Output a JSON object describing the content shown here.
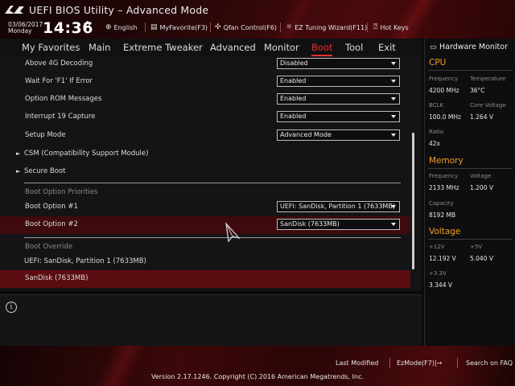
{
  "header": {
    "title": "UEFI BIOS Utility – Advanced Mode",
    "date": "03/06/2017",
    "day": "Monday",
    "time": "14:36",
    "items": [
      {
        "label": "English",
        "icon": "globe-icon"
      },
      {
        "label": "MyFavorite(F3)",
        "icon": "favorite-icon"
      },
      {
        "label": "Qfan Control(F6)",
        "icon": "fan-icon"
      },
      {
        "label": "EZ Tuning Wizard(F11)",
        "icon": "bulb-icon"
      },
      {
        "label": "Hot Keys",
        "icon": "hotkeys-icon"
      }
    ]
  },
  "tabs": [
    {
      "label": "My Favorites",
      "active": false
    },
    {
      "label": "Main",
      "active": false
    },
    {
      "label": "Extreme Tweaker",
      "active": false
    },
    {
      "label": "Advanced",
      "active": false
    },
    {
      "label": "Monitor",
      "active": false
    },
    {
      "label": "Boot",
      "active": true
    },
    {
      "label": "Tool",
      "active": false
    },
    {
      "label": "Exit",
      "active": false
    }
  ],
  "settings": [
    {
      "label": "Above 4G Decoding",
      "value": "Disabled"
    },
    {
      "label": "Wait For 'F1' If Error",
      "value": "Enabled"
    },
    {
      "label": "Option ROM Messages",
      "value": "Enabled"
    },
    {
      "label": "Interrupt 19 Capture",
      "value": "Enabled"
    },
    {
      "label": "Setup Mode",
      "value": "Advanced Mode"
    }
  ],
  "submenus": [
    {
      "label": "CSM (Compatibility Support Module)"
    },
    {
      "label": "Secure Boot"
    }
  ],
  "boot_priorities": {
    "heading": "Boot Option Priorities",
    "options": [
      {
        "label": "Boot Option #1",
        "value": "UEFI: SanDisk, Partition 1 (7633MB)"
      },
      {
        "label": "Boot Option #2",
        "value": "SanDisk  (7633MB)"
      }
    ]
  },
  "boot_override": {
    "heading": "Boot Override",
    "items": [
      {
        "label": "UEFI: SanDisk, Partition 1 (7633MB)"
      },
      {
        "label": "SanDisk  (7633MB)"
      }
    ]
  },
  "hardware_monitor": {
    "title": "Hardware Monitor",
    "cpu": {
      "heading": "CPU",
      "frequency_label": "Frequency",
      "frequency": "4200 MHz",
      "temperature_label": "Temperature",
      "temperature": "36°C",
      "bclk_label": "BCLK",
      "bclk": "100.0 MHz",
      "core_voltage_label": "Core Voltage",
      "core_voltage": "1.264 V",
      "ratio_label": "Ratio",
      "ratio": "42x"
    },
    "memory": {
      "heading": "Memory",
      "frequency_label": "Frequency",
      "frequency": "2133 MHz",
      "voltage_label": "Voltage",
      "voltage": "1.200 V",
      "capacity_label": "Capacity",
      "capacity": "8192 MB"
    },
    "voltage": {
      "heading": "Voltage",
      "v12_label": "+12V",
      "v12": "12.192 V",
      "v5_label": "+5V",
      "v5": "5.040 V",
      "v33_label": "+3.3V",
      "v33": "3.344 V"
    }
  },
  "footer": {
    "last_modified": "Last Modified",
    "ezmode": "EzMode(F7)|→",
    "search": "Search on FAQ",
    "version": "Version 2.17.1246. Copyright (C) 2016 American Megatrends, Inc."
  },
  "colors": {
    "accent": "#e0332b",
    "section": "#f0a020",
    "highlight": "#5b0c10"
  }
}
